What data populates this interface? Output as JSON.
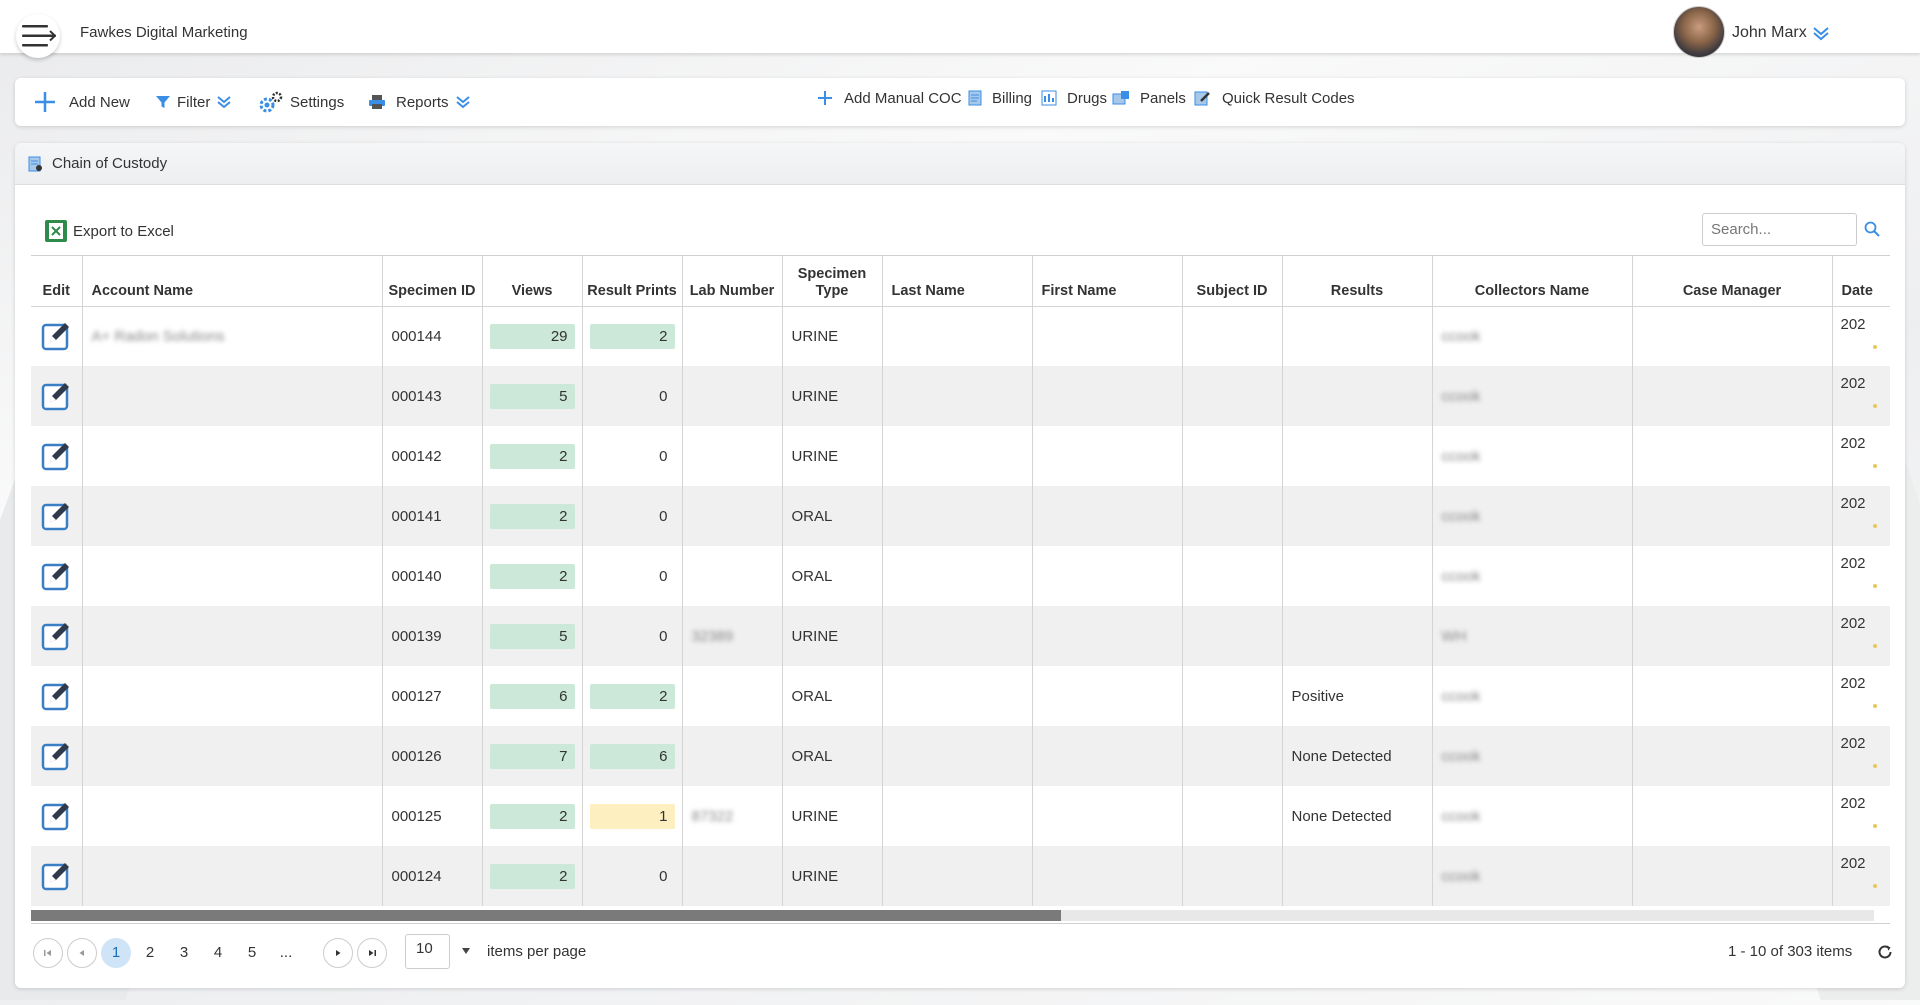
{
  "header": {
    "company": "Fawkes Digital Marketing",
    "user_name": "John Marx"
  },
  "toolbar": {
    "add_new": "Add New",
    "filter": "Filter",
    "settings": "Settings",
    "reports": "Reports",
    "add_manual_coc": "Add Manual COC",
    "billing": "Billing",
    "drugs": "Drugs",
    "panels": "Panels",
    "quick_result_codes": "Quick Result Codes"
  },
  "panel": {
    "title": "Chain of Custody",
    "export": "Export to Excel",
    "search_placeholder": "Search..."
  },
  "table": {
    "columns": {
      "edit": "Edit",
      "account_name": "Account Name",
      "specimen_id": "Specimen ID",
      "views": "Views",
      "result_prints": "Result Prints",
      "lab_number": "Lab Number",
      "specimen_type": "Specimen Type",
      "last_name": "Last Name",
      "first_name": "First Name",
      "subject_id": "Subject ID",
      "results": "Results",
      "collectors_name": "Collectors Name",
      "case_manager": "Case Manager",
      "date": "Date"
    },
    "rows": [
      {
        "account": "A+ Radon Solutions",
        "specimen_id": "000144",
        "views": "29",
        "prints": "2",
        "prints_style": "green",
        "lab": "",
        "type": "URINE",
        "results": "",
        "collector": "ccook",
        "date": "202"
      },
      {
        "account": "",
        "specimen_id": "000143",
        "views": "5",
        "prints": "0",
        "prints_style": "plain",
        "lab": "",
        "type": "URINE",
        "results": "",
        "collector": "ccook",
        "date": "202"
      },
      {
        "account": "",
        "specimen_id": "000142",
        "views": "2",
        "prints": "0",
        "prints_style": "plain",
        "lab": "",
        "type": "URINE",
        "results": "",
        "collector": "ccook",
        "date": "202"
      },
      {
        "account": "",
        "specimen_id": "000141",
        "views": "2",
        "prints": "0",
        "prints_style": "plain",
        "lab": "",
        "type": "ORAL",
        "results": "",
        "collector": "ccook",
        "date": "202"
      },
      {
        "account": "",
        "specimen_id": "000140",
        "views": "2",
        "prints": "0",
        "prints_style": "plain",
        "lab": "",
        "type": "ORAL",
        "results": "",
        "collector": "ccook",
        "date": "202"
      },
      {
        "account": "",
        "specimen_id": "000139",
        "views": "5",
        "prints": "0",
        "prints_style": "plain",
        "lab": "32389",
        "type": "URINE",
        "results": "",
        "collector": "WH",
        "date": "202"
      },
      {
        "account": "",
        "specimen_id": "000127",
        "views": "6",
        "prints": "2",
        "prints_style": "green",
        "lab": "",
        "type": "ORAL",
        "results": "Positive",
        "collector": "ccook",
        "date": "202"
      },
      {
        "account": "",
        "specimen_id": "000126",
        "views": "7",
        "prints": "6",
        "prints_style": "green",
        "lab": "",
        "type": "ORAL",
        "results": "None Detected",
        "collector": "ccook",
        "date": "202"
      },
      {
        "account": "",
        "specimen_id": "000125",
        "views": "2",
        "prints": "1",
        "prints_style": "yellow",
        "lab": "87322",
        "type": "URINE",
        "results": "None Detected",
        "collector": "ccook",
        "date": "202"
      },
      {
        "account": "",
        "specimen_id": "000124",
        "views": "2",
        "prints": "0",
        "prints_style": "plain",
        "lab": "",
        "type": "URINE",
        "results": "",
        "collector": "ccook",
        "date": "202"
      }
    ]
  },
  "pager": {
    "pages": [
      "1",
      "2",
      "3",
      "4",
      "5",
      "..."
    ],
    "active_page": "1",
    "per_page": "10",
    "per_page_label": "items per page",
    "info": "1 - 10 of 303 items"
  },
  "colors": {
    "accent_blue": "#3a8ee6",
    "pill_green": "#cce8d8",
    "pill_yellow": "#fdefbf",
    "active_page_bg": "#cfe4f7"
  }
}
